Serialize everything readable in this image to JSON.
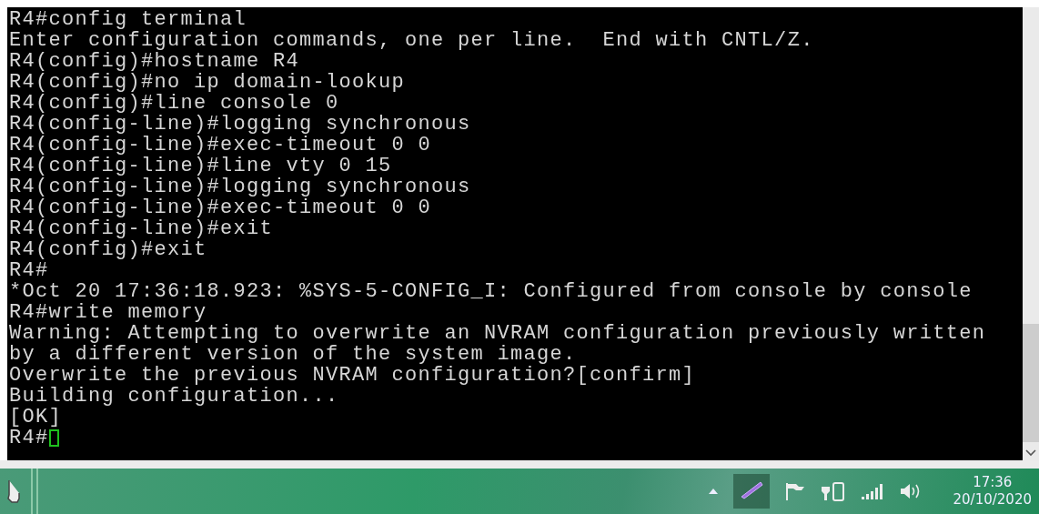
{
  "terminal": {
    "lines": [
      "R4#config terminal",
      "Enter configuration commands, one per line.  End with CNTL/Z.",
      "R4(config)#hostname R4",
      "R4(config)#no ip domain-lookup",
      "R4(config)#line console 0",
      "R4(config-line)#logging synchronous",
      "R4(config-line)#exec-timeout 0 0",
      "R4(config-line)#line vty 0 15",
      "R4(config-line)#logging synchronous",
      "R4(config-line)#exec-timeout 0 0",
      "R4(config-line)#exit",
      "R4(config)#exit",
      "R4#",
      "*Oct 20 17:36:18.923: %SYS-5-CONFIG_I: Configured from console by console",
      "R4#write memory",
      "Warning: Attempting to overwrite an NVRAM configuration previously written",
      "by a different version of the system image.",
      "Overwrite the previous NVRAM configuration?[confirm]",
      "Building configuration...",
      "[OK]"
    ],
    "prompt": "R4#"
  },
  "taskbar": {
    "time": "17:36",
    "date": "20/10/2020"
  }
}
